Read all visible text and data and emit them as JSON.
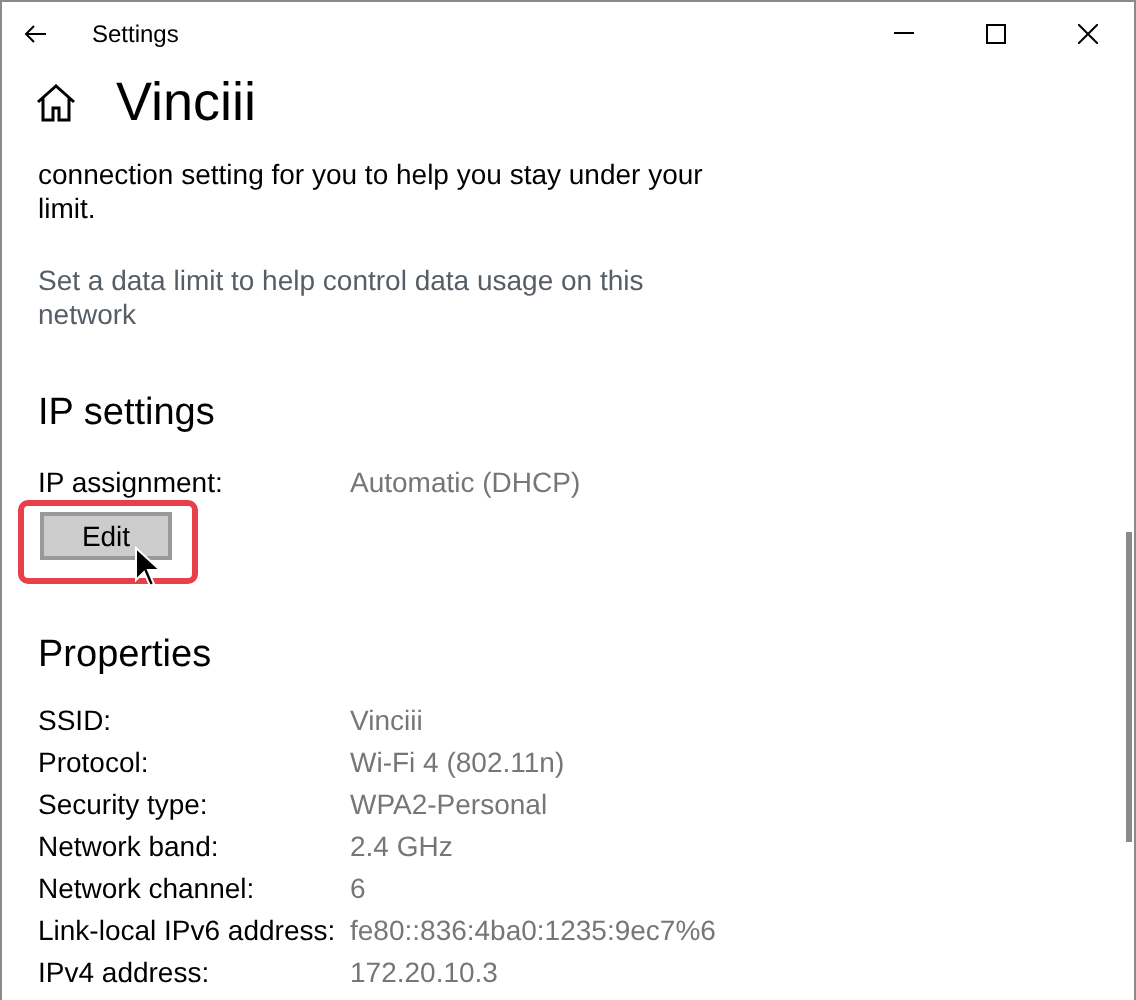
{
  "window": {
    "title": "Settings"
  },
  "page": {
    "title": "Vinciii"
  },
  "data_limit": {
    "text": "connection setting for you to help you stay under your limit.",
    "link": "Set a data limit to help control data usage on this network"
  },
  "ip_settings": {
    "heading": "IP settings",
    "label": "IP assignment:",
    "value": "Automatic (DHCP)",
    "button": "Edit",
    "highlighted": true
  },
  "properties": {
    "heading": "Properties",
    "rows": [
      {
        "label": "SSID:",
        "value": "Vinciii"
      },
      {
        "label": "Protocol:",
        "value": "Wi-Fi 4 (802.11n)"
      },
      {
        "label": "Security type:",
        "value": "WPA2-Personal"
      },
      {
        "label": "Network band:",
        "value": "2.4 GHz"
      },
      {
        "label": "Network channel:",
        "value": "6"
      },
      {
        "label": "Link-local IPv6 address:",
        "value": "fe80::836:4ba0:1235:9ec7%6"
      },
      {
        "label": "IPv4 address:",
        "value": "172.20.10.3"
      }
    ]
  }
}
